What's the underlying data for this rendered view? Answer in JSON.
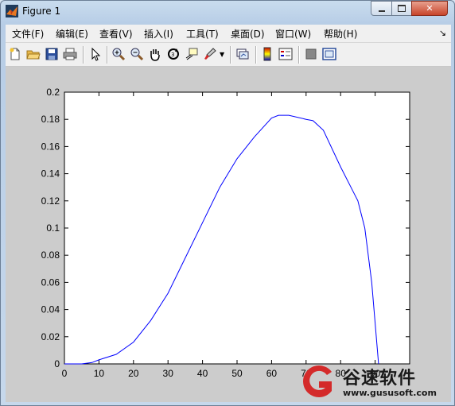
{
  "window": {
    "title": "Figure 1",
    "min_icon": "minimize-icon",
    "max_icon": "maximize-icon",
    "close_icon": "close-icon"
  },
  "menubar": {
    "items": [
      {
        "label": "文件(F)"
      },
      {
        "label": "编辑(E)"
      },
      {
        "label": "查看(V)"
      },
      {
        "label": "插入(I)"
      },
      {
        "label": "工具(T)"
      },
      {
        "label": "桌面(D)"
      },
      {
        "label": "窗口(W)"
      },
      {
        "label": "帮助(H)"
      }
    ]
  },
  "toolbar": {
    "icons": [
      "new-figure-icon",
      "open-file-icon",
      "save-icon",
      "print-icon",
      "pointer-icon",
      "zoom-in-icon",
      "zoom-out-icon",
      "pan-icon",
      "rotate-3d-icon",
      "data-cursor-icon",
      "brush-icon",
      "link-plot-icon",
      "colorbar-icon",
      "legend-icon",
      "hide-plot-tools-icon",
      "show-plot-tools-icon"
    ]
  },
  "watermark": {
    "text": "谷速软件",
    "url": "www.gususoft.com",
    "brand_color": "#d42a2a"
  },
  "chart_data": {
    "type": "line",
    "title": "",
    "xlabel": "",
    "ylabel": "",
    "xlim": [
      0,
      100
    ],
    "ylim": [
      0,
      0.2
    ],
    "xticks": [
      0,
      10,
      20,
      30,
      40,
      50,
      60,
      70,
      80,
      90
    ],
    "yticks": [
      0,
      0.02,
      0.04,
      0.06,
      0.08,
      0.1,
      0.12,
      0.14,
      0.16,
      0.18,
      0.2
    ],
    "ytick_labels": [
      "0",
      "0.02",
      "0.04",
      "0.06",
      "0.08",
      "0.1",
      "0.12",
      "0.14",
      "0.16",
      "0.18",
      "0.2"
    ],
    "series_color": "#0000ff",
    "series": [
      {
        "x": [
          0,
          5,
          8,
          10,
          15,
          20,
          25,
          30,
          35,
          40,
          45,
          50,
          55,
          60,
          62,
          65,
          70,
          72,
          75,
          80,
          83,
          85,
          87,
          89,
          90,
          91
        ],
        "y": [
          0,
          0,
          0.001,
          0.003,
          0.007,
          0.016,
          0.032,
          0.052,
          0.078,
          0.104,
          0.13,
          0.151,
          0.167,
          0.181,
          0.183,
          0.183,
          0.18,
          0.179,
          0.172,
          0.145,
          0.13,
          0.12,
          0.1,
          0.06,
          0.03,
          0
        ]
      }
    ]
  }
}
